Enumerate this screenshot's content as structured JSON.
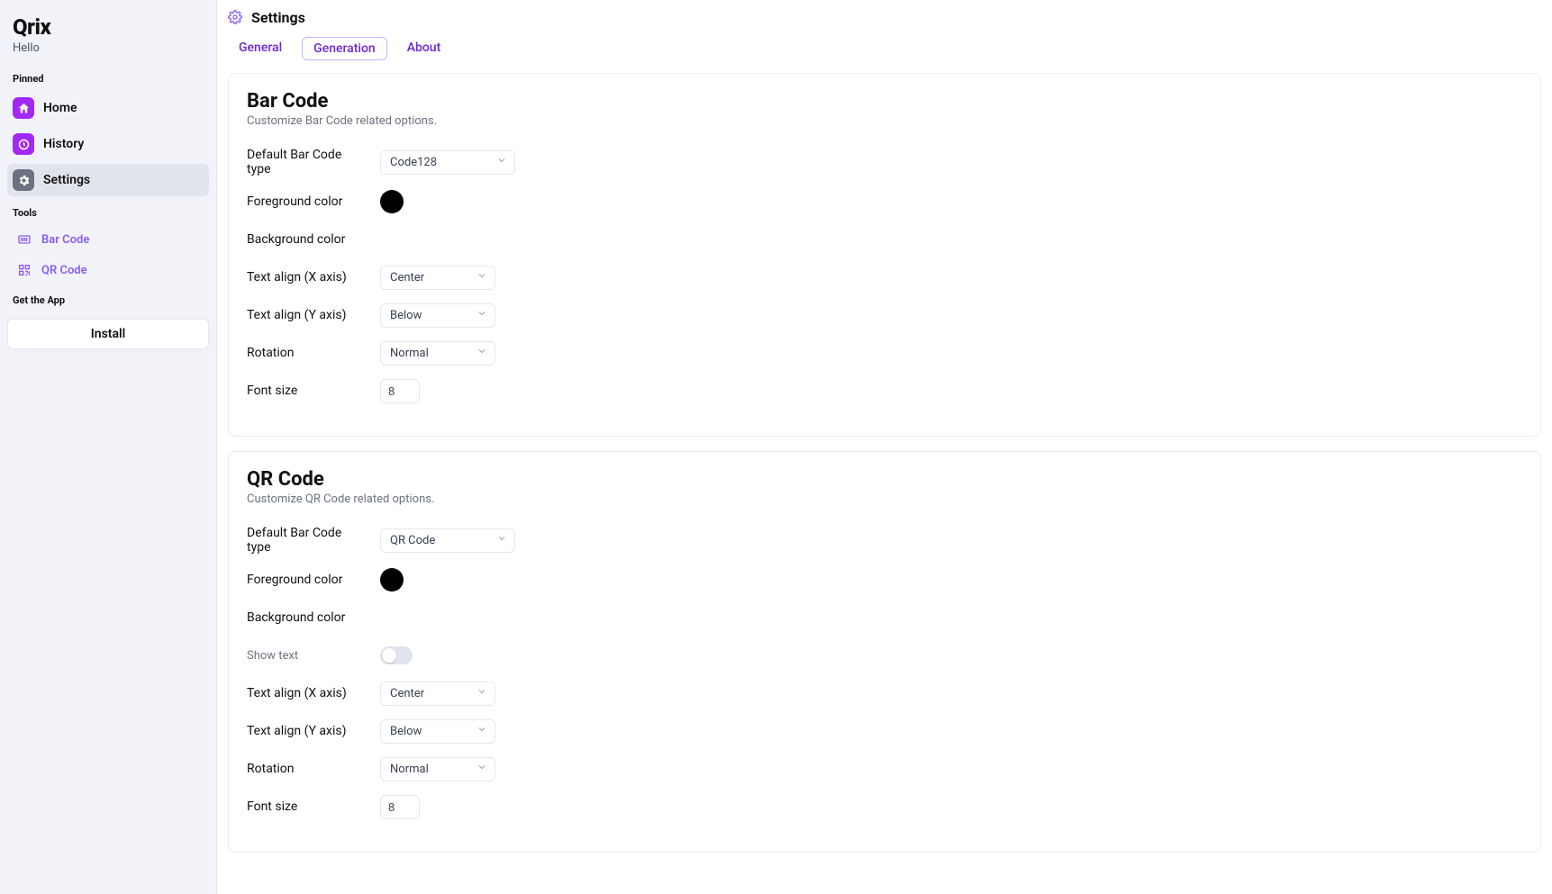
{
  "brand": {
    "name": "Qrix",
    "subtitle": "Hello"
  },
  "sidebar": {
    "pinned_label": "Pinned",
    "nav": {
      "home": "Home",
      "history": "History",
      "settings": "Settings"
    },
    "tools_label": "Tools",
    "tools": {
      "barcode": "Bar Code",
      "qrcode": "QR Code"
    },
    "get_app_label": "Get the App",
    "install": "Install"
  },
  "page": {
    "title": "Settings"
  },
  "tabs": {
    "general": "General",
    "generation": "Generation",
    "about": "About"
  },
  "barcode": {
    "title": "Bar Code",
    "subtitle": "Customize Bar Code related options.",
    "fields": {
      "default_type_label": "Default Bar Code type",
      "default_type_value": "Code128",
      "foreground_label": "Foreground color",
      "foreground_value": "#000000",
      "background_label": "Background color",
      "text_align_x_label": "Text align (X axis)",
      "text_align_x_value": "Center",
      "text_align_y_label": "Text align (Y axis)",
      "text_align_y_value": "Below",
      "rotation_label": "Rotation",
      "rotation_value": "Normal",
      "font_size_label": "Font size",
      "font_size_value": "8"
    }
  },
  "qrcode": {
    "title": "QR Code",
    "subtitle": "Customize QR Code related options.",
    "fields": {
      "default_type_label": "Default Bar Code type",
      "default_type_value": "QR Code",
      "foreground_label": "Foreground color",
      "foreground_value": "#000000",
      "background_label": "Background color",
      "show_text_label": "Show text",
      "text_align_x_label": "Text align (X axis)",
      "text_align_x_value": "Center",
      "text_align_y_label": "Text align (Y axis)",
      "text_align_y_value": "Below",
      "rotation_label": "Rotation",
      "rotation_value": "Normal",
      "font_size_label": "Font size",
      "font_size_value": "8"
    }
  }
}
